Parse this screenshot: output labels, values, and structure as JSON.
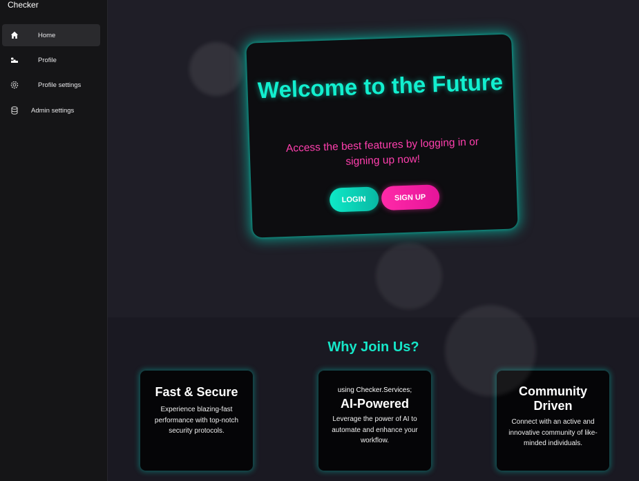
{
  "app": {
    "brand": "Checker"
  },
  "sidebar": {
    "items": [
      {
        "label": "Home",
        "icon": "home-icon",
        "active": true
      },
      {
        "label": "Profile",
        "icon": "profile-icon",
        "active": false
      },
      {
        "label": "Profile settings",
        "icon": "gear-icon",
        "active": false
      },
      {
        "label": "Admin settings",
        "icon": "database-icon",
        "active": false
      }
    ]
  },
  "hero": {
    "title": "Welcome to the Future",
    "subtitle": "Access the best features by logging in or signing up now!",
    "login_label": "LOGIN",
    "signup_label": "SIGN UP"
  },
  "features": {
    "heading": "Why Join Us?",
    "cards": [
      {
        "title": "Fast & Secure",
        "description": "Experience blazing-fast performance with top-notch security protocols."
      },
      {
        "note": "using Checker.Services;",
        "title": "AI-Powered",
        "description": "Leverage the power of AI to automate and enhance your workflow."
      },
      {
        "title": "Community Driven",
        "description": "Connect with an active and innovative community of like-minded individuals."
      }
    ]
  },
  "colors": {
    "accent_teal": "#12efcf",
    "accent_pink": "#ff3fae",
    "sidebar_bg": "#151517",
    "card_bg": "#0d0d10"
  }
}
